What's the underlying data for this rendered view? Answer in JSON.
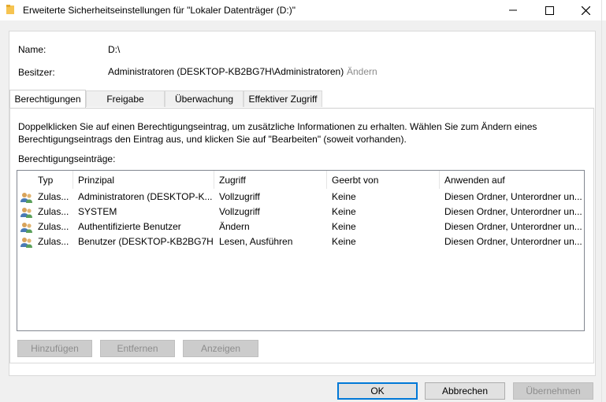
{
  "window": {
    "title": "Erweiterte Sicherheitseinstellungen für \"Lokaler Datenträger (D:)\"",
    "controls": {
      "minimize": "—",
      "maximize": "☐",
      "close": "✕"
    }
  },
  "info": {
    "name_label": "Name:",
    "name_value": "D:\\",
    "owner_label": "Besitzer:",
    "owner_value": "Administratoren (DESKTOP-KB2BG7H\\Administratoren)",
    "change_link": "Ändern"
  },
  "tabs": [
    {
      "label": "Berechtigungen",
      "active": true
    },
    {
      "label": "Freigabe",
      "active": false
    },
    {
      "label": "Überwachung",
      "active": false
    },
    {
      "label": "Effektiver Zugriff",
      "active": false
    }
  ],
  "permissions": {
    "description": "Doppelklicken Sie auf einen Berechtigungseintrag, um zusätzliche Informationen zu erhalten. Wählen Sie zum Ändern eines Berechtigungseintrags den Eintrag aus, und klicken Sie auf \"Bearbeiten\" (soweit vorhanden).",
    "entries_label": "Berechtigungseinträge:",
    "columns": [
      "Typ",
      "Prinzipal",
      "Zugriff",
      "Geerbt von",
      "Anwenden auf"
    ],
    "rows": [
      {
        "type": "Zulas...",
        "principal": "Administratoren (DESKTOP-K...",
        "access": "Vollzugriff",
        "inherited": "Keine",
        "applies": "Diesen Ordner, Unterordner un..."
      },
      {
        "type": "Zulas...",
        "principal": "SYSTEM",
        "access": "Vollzugriff",
        "inherited": "Keine",
        "applies": "Diesen Ordner, Unterordner un..."
      },
      {
        "type": "Zulas...",
        "principal": "Authentifizierte Benutzer",
        "access": "Ändern",
        "inherited": "Keine",
        "applies": "Diesen Ordner, Unterordner un..."
      },
      {
        "type": "Zulas...",
        "principal": "Benutzer (DESKTOP-KB2BG7H...",
        "access": "Lesen, Ausführen",
        "inherited": "Keine",
        "applies": "Diesen Ordner, Unterordner un..."
      }
    ],
    "buttons": {
      "add": "Hinzufügen",
      "remove": "Entfernen",
      "view": "Anzeigen"
    }
  },
  "dialog_buttons": {
    "ok": "OK",
    "cancel": "Abbrechen",
    "apply": "Übernehmen"
  },
  "colors": {
    "accent": "#0078d7",
    "disabled_text": "#8d8d8d",
    "link_disabled": "#8a8a8a"
  }
}
